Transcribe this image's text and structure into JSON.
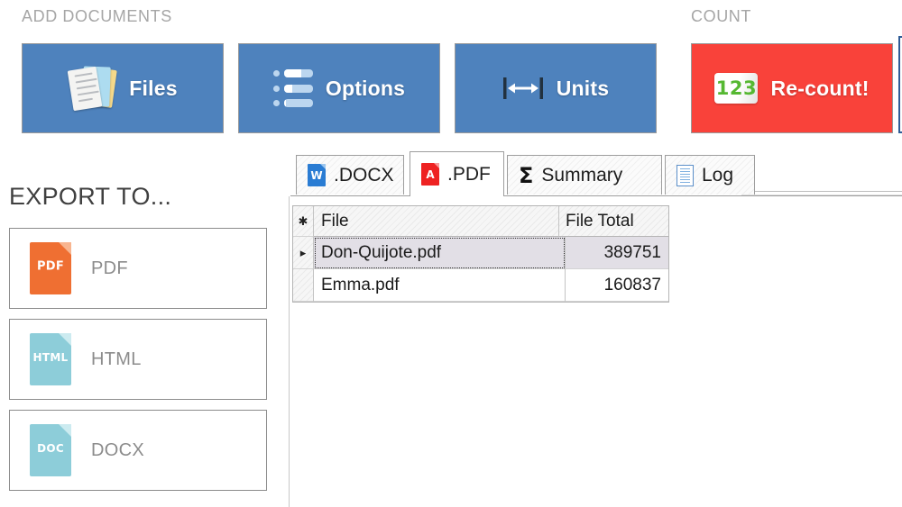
{
  "sections": {
    "add_documents_caption": "ADD DOCUMENTS",
    "count_caption": "COUNT",
    "export_title": "EXPORT TO..."
  },
  "ribbon": {
    "buttons": [
      {
        "label": "Files",
        "icon": "stacked-files-icon",
        "color": "#4e82bd"
      },
      {
        "label": "Options",
        "icon": "bullet-list-icon",
        "color": "#4e82bd"
      },
      {
        "label": "Units",
        "icon": "horizontal-arrows-icon",
        "color": "#4e82bd"
      },
      {
        "label": "Re-count!",
        "icon": "123-icon",
        "color": "#f9423a"
      }
    ]
  },
  "export": {
    "items": [
      {
        "label": "PDF",
        "tag": "PDF",
        "icon": "pdf-file-icon",
        "color": "#ef6f32"
      },
      {
        "label": "HTML",
        "tag": "HTML",
        "icon": "html-file-icon",
        "color": "#8dcdd9"
      },
      {
        "label": "DOCX",
        "tag": "DOC",
        "icon": "docx-file-icon",
        "color": "#8dcdd9"
      }
    ]
  },
  "tabs": [
    {
      "label": ".DOCX",
      "icon": "word-document-icon",
      "active": false
    },
    {
      "label": ".PDF",
      "icon": "pdf-document-icon",
      "active": true
    },
    {
      "label": "Summary",
      "icon": "sigma-icon",
      "active": false
    },
    {
      "label": "Log",
      "icon": "log-document-icon",
      "active": false
    }
  ],
  "grid": {
    "row_marker_new": "✱",
    "row_marker_current": "▸",
    "columns": [
      "File",
      "File Total"
    ],
    "rows": [
      {
        "file": "Don-Quijote.pdf",
        "total": "389751",
        "selected": true
      },
      {
        "file": "Emma.pdf",
        "total": "160837",
        "selected": false
      }
    ]
  }
}
